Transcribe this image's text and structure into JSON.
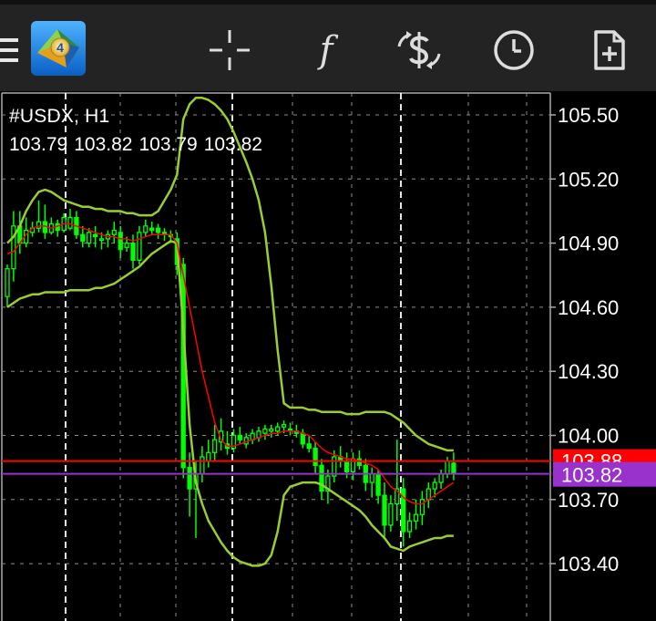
{
  "toolbar": {
    "menu_icon": "hamburger-menu-icon",
    "logo_icon": "metatrader-4-logo",
    "logo_text": "4",
    "buttons": [
      {
        "name": "crosshair",
        "icon": "crosshair-icon"
      },
      {
        "name": "indicators",
        "icon": "function-f-icon",
        "glyph": "f"
      },
      {
        "name": "trade",
        "icon": "dollar-exchange-icon"
      },
      {
        "name": "timeframe",
        "icon": "clock-icon"
      },
      {
        "name": "new-order",
        "icon": "document-plus-icon"
      }
    ]
  },
  "chart_header": {
    "symbol_timeframe": "#USDX, H1",
    "ohlc": [
      "103.79",
      "103.82",
      "103.79",
      "103.82"
    ]
  },
  "colors": {
    "background": "#000000",
    "toolbar": "#232323",
    "bull_candle": "#00ff00",
    "bollinger": "#9acd32",
    "moving_average": "#ff0000",
    "bid_line": "#9932cc",
    "ask_line": "#ff0000",
    "grid": "#8c8c8c",
    "axis_text": "#ffffff"
  },
  "chart_data": {
    "type": "candlestick",
    "symbol": "#USDX",
    "timeframe": "H1",
    "ylim": [
      103.2,
      105.6
    ],
    "y_ticks": [
      105.5,
      105.2,
      104.9,
      104.6,
      104.3,
      104.0,
      103.7,
      103.4
    ],
    "y_tick_labels": [
      "105.50",
      "105.20",
      "104.90",
      "104.60",
      "104.30",
      "104.00",
      "103.70",
      "103.40"
    ],
    "ask_price": 103.88,
    "ask_label": "103.88",
    "bid_price": 103.82,
    "bid_label": "103.82",
    "candles": [
      [
        104.65,
        104.8,
        104.6,
        104.78
      ],
      [
        104.78,
        105.05,
        104.72,
        104.98
      ],
      [
        104.98,
        105.05,
        104.85,
        104.9
      ],
      [
        104.9,
        105.02,
        104.88,
        104.96
      ],
      [
        104.95,
        105.0,
        104.93,
        104.97
      ],
      [
        104.97,
        105.1,
        104.95,
        105.0
      ],
      [
        105.0,
        105.08,
        104.92,
        104.95
      ],
      [
        104.95,
        105.02,
        104.94,
        104.99
      ],
      [
        104.99,
        105.01,
        104.93,
        104.96
      ],
      [
        104.96,
        105.04,
        104.95,
        105.02
      ],
      [
        104.97,
        105.06,
        104.96,
        105.02
      ],
      [
        105.02,
        105.05,
        104.92,
        104.94
      ],
      [
        104.94,
        104.98,
        104.88,
        104.91
      ],
      [
        104.9,
        104.97,
        104.88,
        104.95
      ],
      [
        104.94,
        104.98,
        104.88,
        104.93
      ],
      [
        104.92,
        104.95,
        104.87,
        104.92
      ],
      [
        104.92,
        104.96,
        104.88,
        104.94
      ],
      [
        104.94,
        105.0,
        104.9,
        104.96
      ],
      [
        104.95,
        104.98,
        104.83,
        104.87
      ],
      [
        104.88,
        104.93,
        104.86,
        104.9
      ],
      [
        104.9,
        104.94,
        104.78,
        104.82
      ],
      [
        104.82,
        104.98,
        104.8,
        104.95
      ],
      [
        104.95,
        105.01,
        104.93,
        104.98
      ],
      [
        104.97,
        105.0,
        104.94,
        104.96
      ],
      [
        104.97,
        104.99,
        104.92,
        104.95
      ],
      [
        104.95,
        104.97,
        104.91,
        104.94
      ],
      [
        104.94,
        104.96,
        104.9,
        104.93
      ],
      [
        104.92,
        104.95,
        104.75,
        104.8
      ],
      [
        104.8,
        104.83,
        103.8,
        103.85
      ],
      [
        103.85,
        103.92,
        103.62,
        103.75
      ],
      [
        103.75,
        103.88,
        103.52,
        103.82
      ],
      [
        103.82,
        103.95,
        103.78,
        103.9
      ],
      [
        103.88,
        103.98,
        103.85,
        103.92
      ],
      [
        103.92,
        104.05,
        103.88,
        103.98
      ],
      [
        103.97,
        104.08,
        103.93,
        104.02
      ],
      [
        103.96,
        104.02,
        103.91,
        103.94
      ],
      [
        103.94,
        104.03,
        103.92,
        104.0
      ],
      [
        104.0,
        104.04,
        103.96,
        103.98
      ],
      [
        103.96,
        104.01,
        103.94,
        103.99
      ],
      [
        103.98,
        104.03,
        103.96,
        104.01
      ],
      [
        103.99,
        104.04,
        103.97,
        104.02
      ],
      [
        104.01,
        104.05,
        103.98,
        104.03
      ],
      [
        104.02,
        104.05,
        103.99,
        104.03
      ],
      [
        104.02,
        104.06,
        104.0,
        104.04
      ],
      [
        104.04,
        104.07,
        104.01,
        104.05
      ],
      [
        104.03,
        104.06,
        104.0,
        104.02
      ],
      [
        104.02,
        104.05,
        103.99,
        104.01
      ],
      [
        104.01,
        104.03,
        103.94,
        103.96
      ],
      [
        103.96,
        104.0,
        103.92,
        103.94
      ],
      [
        103.94,
        103.97,
        103.82,
        103.86
      ],
      [
        103.86,
        103.89,
        103.7,
        103.74
      ],
      [
        103.74,
        103.84,
        103.68,
        103.81
      ],
      [
        103.81,
        103.93,
        103.78,
        103.9
      ],
      [
        103.9,
        103.95,
        103.85,
        103.88
      ],
      [
        103.88,
        103.92,
        103.8,
        103.83
      ],
      [
        103.83,
        103.92,
        103.79,
        103.89
      ],
      [
        103.89,
        103.93,
        103.84,
        103.86
      ],
      [
        103.86,
        103.89,
        103.74,
        103.78
      ],
      [
        103.78,
        103.85,
        103.71,
        103.82
      ],
      [
        103.82,
        103.84,
        103.68,
        103.72
      ],
      [
        103.72,
        103.78,
        103.52,
        103.58
      ],
      [
        103.58,
        103.72,
        103.55,
        103.68
      ],
      [
        103.68,
        103.98,
        103.6,
        103.75
      ],
      [
        103.75,
        103.8,
        103.48,
        103.55
      ],
      [
        103.55,
        103.64,
        103.52,
        103.6
      ],
      [
        103.6,
        103.7,
        103.56,
        103.63
      ],
      [
        103.63,
        103.74,
        103.58,
        103.7
      ],
      [
        103.7,
        103.78,
        103.66,
        103.75
      ],
      [
        103.75,
        103.8,
        103.71,
        103.78
      ],
      [
        103.78,
        103.84,
        103.75,
        103.82
      ],
      [
        103.82,
        103.9,
        103.8,
        103.88
      ],
      [
        103.87,
        103.92,
        103.79,
        103.82
      ]
    ],
    "moving_average": [
      104.85,
      104.86,
      104.9,
      104.94,
      104.97,
      104.98,
      104.98,
      104.97,
      104.98,
      104.99,
      104.99,
      104.98,
      104.97,
      104.96,
      104.95,
      104.94,
      104.93,
      104.93,
      104.92,
      104.92,
      104.91,
      104.92,
      104.93,
      104.94,
      104.94,
      104.94,
      104.94,
      104.9,
      104.75,
      104.6,
      104.45,
      104.3,
      104.18,
      104.06,
      103.98,
      103.95,
      103.95,
      103.96,
      103.97,
      103.98,
      103.99,
      104.0,
      104.01,
      104.01,
      104.02,
      104.02,
      104.02,
      104.01,
      104.0,
      103.97,
      103.94,
      103.92,
      103.91,
      103.9,
      103.89,
      103.89,
      103.88,
      103.87,
      103.86,
      103.84,
      103.8,
      103.76,
      103.74,
      103.71,
      103.69,
      103.68,
      103.68,
      103.7,
      103.72,
      103.74,
      103.76,
      103.78
    ],
    "bollinger_upper": [
      104.9,
      104.93,
      104.98,
      105.05,
      105.1,
      105.14,
      105.15,
      105.14,
      105.12,
      105.1,
      105.09,
      105.08,
      105.07,
      105.07,
      105.06,
      105.06,
      105.05,
      105.05,
      105.05,
      105.04,
      105.04,
      105.03,
      105.03,
      105.03,
      105.05,
      105.1,
      105.15,
      105.22,
      105.48,
      105.55,
      105.58,
      105.58,
      105.57,
      105.55,
      105.52,
      105.48,
      105.42,
      105.35,
      105.28,
      105.2,
      105.1,
      104.95,
      104.7,
      104.4,
      104.15,
      104.13,
      104.13,
      104.13,
      104.12,
      104.12,
      104.11,
      104.11,
      104.11,
      104.11,
      104.1,
      104.1,
      104.1,
      104.11,
      104.11,
      104.11,
      104.11,
      104.1,
      104.08,
      104.06,
      104.03,
      104.0,
      103.98,
      103.96,
      103.95,
      103.94,
      103.93,
      103.93
    ],
    "bollinger_lower": [
      104.6,
      104.62,
      104.64,
      104.65,
      104.66,
      104.66,
      104.67,
      104.67,
      104.67,
      104.67,
      104.68,
      104.68,
      104.68,
      104.68,
      104.69,
      104.69,
      104.7,
      104.71,
      104.73,
      104.75,
      104.77,
      104.79,
      104.82,
      104.85,
      104.87,
      104.89,
      104.91,
      104.9,
      104.5,
      104.05,
      103.78,
      103.68,
      103.6,
      103.55,
      103.5,
      103.46,
      103.43,
      103.41,
      103.4,
      103.39,
      103.39,
      103.4,
      103.44,
      103.55,
      103.72,
      103.76,
      103.77,
      103.78,
      103.78,
      103.78,
      103.77,
      103.75,
      103.73,
      103.71,
      103.69,
      103.67,
      103.65,
      103.62,
      103.58,
      103.55,
      103.52,
      103.48,
      103.47,
      103.46,
      103.48,
      103.49,
      103.5,
      103.51,
      103.52,
      103.52,
      103.53,
      103.53
    ]
  }
}
